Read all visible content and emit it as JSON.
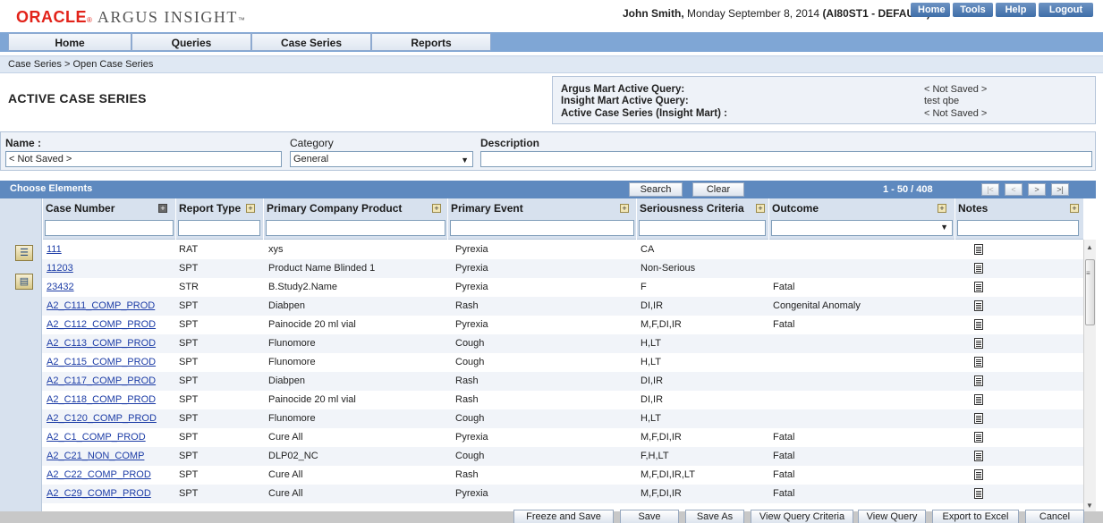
{
  "app": {
    "logo_brand": "ORACLE",
    "logo_product": "ARGUS INSIGHT",
    "logo_tm": "™",
    "logo_reg": "®"
  },
  "header": {
    "user_name": "John Smith,",
    "date_text": " Monday September 8, 2014 ",
    "db_text": "(AI80ST1 - DEFAULT)",
    "top_links": [
      "Home",
      "Tools",
      "Help",
      "Logout"
    ]
  },
  "nav": {
    "tabs": [
      "Home",
      "Queries",
      "Case Series",
      "Reports"
    ]
  },
  "breadcrumb": "Case Series > Open Case Series",
  "page": {
    "title": "ACTIVE CASE SERIES"
  },
  "active_query": {
    "rows": [
      {
        "label": "Argus Mart Active Query:",
        "value": "< Not Saved >"
      },
      {
        "label": "Insight Mart Active Query:",
        "value": "test qbe"
      },
      {
        "label": "Active Case Series (Insight Mart) :",
        "value": "< Not Saved >"
      }
    ]
  },
  "meta": {
    "name_label": "Name :",
    "name_value": "< Not Saved >",
    "category_label": "Category",
    "category_value": "General",
    "description_label": "Description",
    "description_value": ""
  },
  "grid": {
    "title": "Choose Elements",
    "search_label": "Search",
    "clear_label": "Clear",
    "range_text": "1 - 50 / 408",
    "pager": [
      "|<",
      "<",
      ">",
      ">|"
    ],
    "columns": [
      "Case Number",
      "Report Type",
      "Primary Company Product",
      "Primary Event",
      "Seriousness Criteria",
      "Outcome",
      "Notes"
    ],
    "rows": [
      [
        "111",
        "RAT",
        "xys",
        "Pyrexia",
        "CA",
        ""
      ],
      [
        "11203",
        "SPT",
        "Product Name Blinded 1",
        "Pyrexia",
        "Non-Serious",
        ""
      ],
      [
        "23432",
        "STR",
        "B.Study2.Name",
        "Pyrexia",
        "F",
        "Fatal"
      ],
      [
        "A2_C111_COMP_PROD",
        "SPT",
        "Diabpen",
        "Rash",
        "DI,IR",
        "Congenital Anomaly"
      ],
      [
        "A2_C112_COMP_PROD",
        "SPT",
        "Painocide 20 ml vial",
        "Pyrexia",
        "M,F,DI,IR",
        "Fatal"
      ],
      [
        "A2_C113_COMP_PROD",
        "SPT",
        "Flunomore",
        "Cough",
        "H,LT",
        ""
      ],
      [
        "A2_C115_COMP_PROD",
        "SPT",
        "Flunomore",
        "Cough",
        "H,LT",
        ""
      ],
      [
        "A2_C117_COMP_PROD",
        "SPT",
        "Diabpen",
        "Rash",
        "DI,IR",
        ""
      ],
      [
        "A2_C118_COMP_PROD",
        "SPT",
        "Painocide 20 ml vial",
        "Rash",
        "DI,IR",
        ""
      ],
      [
        "A2_C120_COMP_PROD",
        "SPT",
        "Flunomore",
        "Cough",
        "H,LT",
        ""
      ],
      [
        "A2_C1_COMP_PROD",
        "SPT",
        "Cure All",
        "Pyrexia",
        "M,F,DI,IR",
        "Fatal"
      ],
      [
        "A2_C21_NON_COMP",
        "SPT",
        "DLP02_NC",
        "Cough",
        "F,H,LT",
        "Fatal"
      ],
      [
        "A2_C22_COMP_PROD",
        "SPT",
        "Cure All",
        "Rash",
        "M,F,DI,IR,LT",
        "Fatal"
      ],
      [
        "A2_C29_COMP_PROD",
        "SPT",
        "Cure All",
        "Pyrexia",
        "M,F,DI,IR",
        "Fatal"
      ]
    ]
  },
  "buttons": [
    "Freeze and Save",
    "Save",
    "Save As",
    "View Query Criteria",
    "View Query",
    "Export to Excel",
    "Cancel"
  ]
}
